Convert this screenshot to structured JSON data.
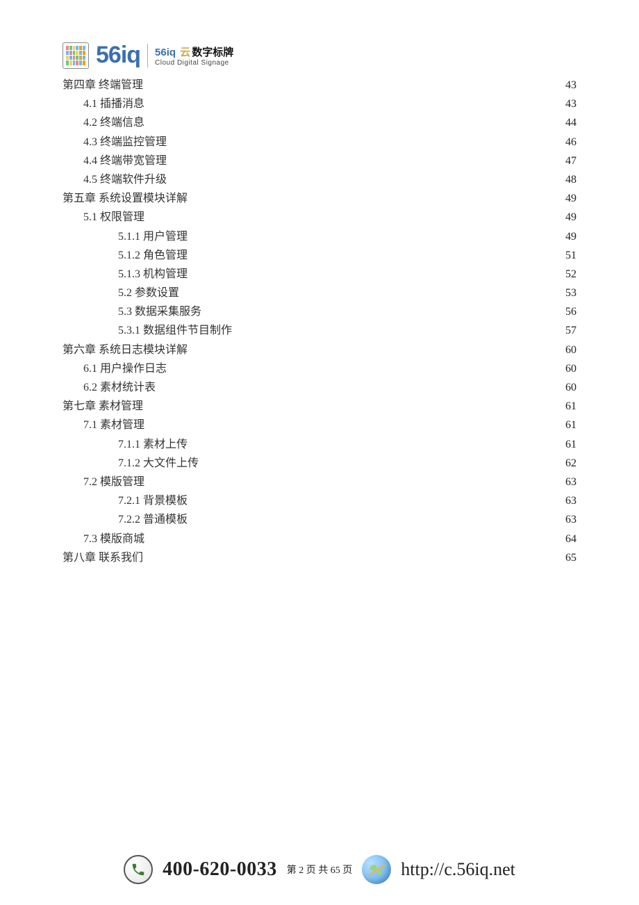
{
  "header": {
    "brand": "56iq",
    "sub_brand": "56iq",
    "sub_gold": "云",
    "sub_black": "数字标牌",
    "sub_en": "Cloud  Digital  Signage"
  },
  "toc": [
    {
      "level": 0,
      "title": "第四章  终端管理",
      "page": "43"
    },
    {
      "level": 1,
      "title": "4.1 插播消息",
      "page": "43"
    },
    {
      "level": 1,
      "title": "4.2 终端信息",
      "page": "44"
    },
    {
      "level": 1,
      "title": "4.3 终端监控管理",
      "page": "46"
    },
    {
      "level": 1,
      "title": "4.4 终端带宽管理",
      "page": "47"
    },
    {
      "level": 1,
      "title": "4.5 终端软件升级",
      "page": "48"
    },
    {
      "level": 0,
      "title": "第五章  系统设置模块详解",
      "page": "49"
    },
    {
      "level": 1,
      "title": "5.1 权限管理",
      "page": "49"
    },
    {
      "level": 2,
      "title": "5.1.1 用户管理",
      "page": "49"
    },
    {
      "level": 2,
      "title": "5.1.2 角色管理",
      "page": "51"
    },
    {
      "level": 2,
      "title": "5.1.3 机构管理",
      "page": "52"
    },
    {
      "level": 2,
      "title": "5.2 参数设置",
      "page": "53"
    },
    {
      "level": 2,
      "title": "5.3 数据采集服务",
      "page": "56"
    },
    {
      "level": 2,
      "title": "5.3.1 数据组件节目制作",
      "page": "57"
    },
    {
      "level": 0,
      "title": "第六章  系统日志模块详解",
      "page": "60"
    },
    {
      "level": 1,
      "title": "6.1 用户操作日志",
      "page": "60"
    },
    {
      "level": 1,
      "title": "6.2 素材统计表",
      "page": "60"
    },
    {
      "level": 0,
      "title": "第七章  素材管理",
      "page": "61"
    },
    {
      "level": 1,
      "title": "7.1 素材管理",
      "page": "61"
    },
    {
      "level": 2,
      "title": "7.1.1 素材上传",
      "page": "61"
    },
    {
      "level": 2,
      "title": "7.1.2 大文件上传",
      "page": "62"
    },
    {
      "level": 1,
      "title": "7.2 模版管理",
      "page": "63"
    },
    {
      "level": 2,
      "title": "7.2.1 背景模板",
      "page": "63"
    },
    {
      "level": 2,
      "title": "7.2.2 普通模板",
      "page": "63"
    },
    {
      "level": 1,
      "title": "7.3 模版商城",
      "page": "64"
    },
    {
      "level": 0,
      "title": "第八章  联系我们",
      "page": "65"
    }
  ],
  "footer": {
    "phone": "400-620-0033",
    "page_info": "第 2 页 共 65 页",
    "url": "http://c.56iq.net"
  },
  "square_colors": [
    "#e88",
    "#6c7",
    "#fc6",
    "#6bf",
    "#f90",
    "#6bf",
    "#6bf",
    "#e88",
    "#6c7",
    "#fc6",
    "#6bf",
    "#f90",
    "#fc6",
    "#6bf",
    "#e88",
    "#6c7",
    "#f90",
    "#6bf",
    "#6c7",
    "#fc6",
    "#6bf",
    "#e88",
    "#6bf",
    "#f90"
  ]
}
